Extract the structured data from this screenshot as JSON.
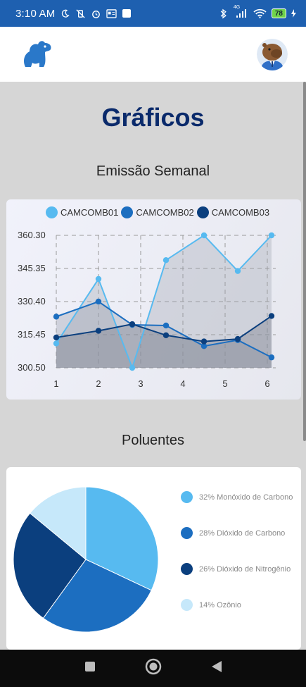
{
  "status_bar": {
    "time": "3:10 AM",
    "network": "4G",
    "battery": "78"
  },
  "header": {
    "logo_icon": "capybara-logo-icon",
    "avatar_icon": "capybara-avatar-icon"
  },
  "page": {
    "title": "Gráficos"
  },
  "line_section": {
    "title": "Emissão Semanal"
  },
  "pie_section": {
    "title": "Poluentes"
  },
  "colors": {
    "series1": "#57baf0",
    "series2": "#1c6ec0",
    "series3": "#0b3f7e",
    "series4": "#c6e8fa"
  },
  "chart_data": [
    {
      "type": "line",
      "title": "Emissão Semanal",
      "x": [
        1,
        2,
        3,
        4,
        5,
        6
      ],
      "yticks": [
        "300.50",
        "315.45",
        "330.40",
        "345.35",
        "360.30"
      ],
      "ylim": [
        300.5,
        360.3
      ],
      "grid": true,
      "legend": "top",
      "series": [
        {
          "name": "CAMCOMB01",
          "values": [
            311.5,
            340.6,
            300.5,
            349.1,
            360.3,
            344.2,
            360.3
          ],
          "x": [
            1,
            2,
            2.8,
            3.6,
            4.5,
            5.3,
            6.1
          ]
        },
        {
          "name": "CAMCOMB02",
          "values": [
            323.6,
            330.4,
            319.9,
            319.6,
            310.3,
            313.0,
            305.2
          ],
          "x": [
            1,
            2,
            2.8,
            3.6,
            4.5,
            5.3,
            6.1
          ]
        },
        {
          "name": "CAMCOMB03",
          "values": [
            314.2,
            317.2,
            320.2,
            315.2,
            312.4,
            313.5,
            323.9
          ],
          "x": [
            1,
            2,
            2.8,
            3.6,
            4.5,
            5.3,
            6.1
          ]
        }
      ]
    },
    {
      "type": "pie",
      "title": "Poluentes",
      "legend": "right",
      "slices": [
        {
          "label": "32% Monóxido de Carbono",
          "value": 32
        },
        {
          "label": "28% Dióxido de Carbono",
          "value": 28
        },
        {
          "label": "26% Dióxido de Nitrogênio",
          "value": 26
        },
        {
          "label": "14% Ozônio",
          "value": 14
        }
      ]
    }
  ]
}
